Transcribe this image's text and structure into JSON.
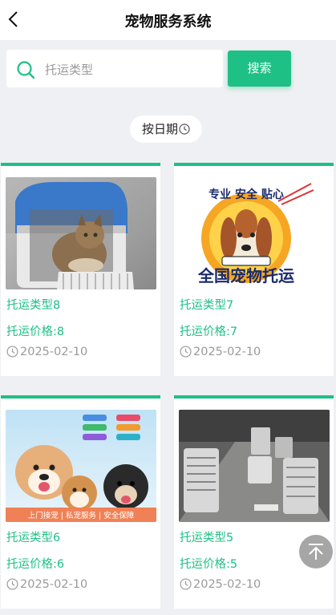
{
  "header": {
    "title": "宠物服务系统"
  },
  "search": {
    "placeholder": "托运类型",
    "button_label": "搜索"
  },
  "sort": {
    "label": "按日期"
  },
  "colors": {
    "accent": "#1ec085",
    "background": "#eff0f3"
  },
  "cards": [
    {
      "type": "托运类型8",
      "price": "托运价格:8",
      "date": "2025-02-10"
    },
    {
      "type": "托运类型7",
      "price": "托运价格:7",
      "date": "2025-02-10",
      "image_text": {
        "top": "专业 安全 贴心",
        "bottom": "全国宠物托运"
      }
    },
    {
      "type": "托运类型6",
      "price": "托运价格:6",
      "date": "2025-02-10",
      "image_text": {
        "banner": "上门接宠 | 私宠服务 | 安全保障"
      }
    },
    {
      "type": "托运类型5",
      "price": "托运价格:5",
      "date": "2025-02-10"
    }
  ],
  "icons": [
    "back-arrow-icon",
    "search-icon",
    "clock-icon",
    "back-to-top-icon"
  ]
}
